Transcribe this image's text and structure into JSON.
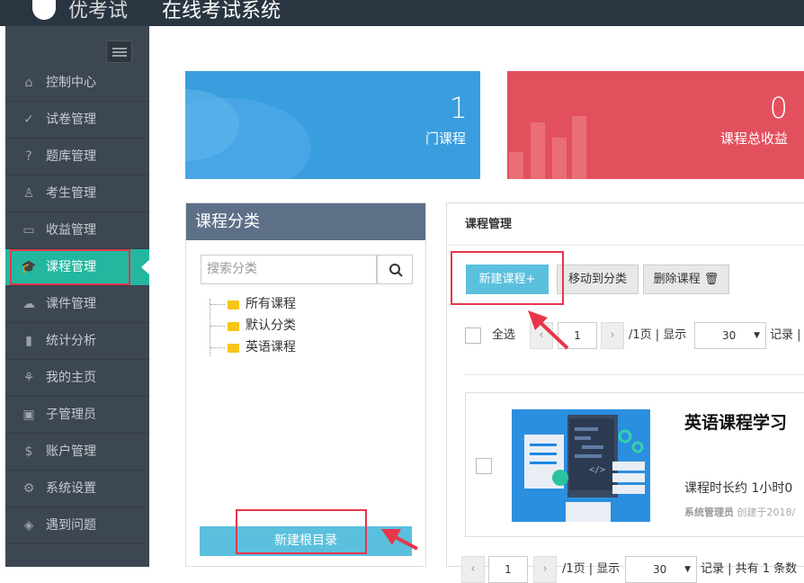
{
  "header": {
    "logo_text": "优考试",
    "title": "在线考试系统"
  },
  "sidebar": {
    "items": [
      {
        "icon": "home-icon",
        "glyph": "⌂",
        "label": "控制中心"
      },
      {
        "icon": "check-circle-icon",
        "glyph": "✓",
        "label": "试卷管理"
      },
      {
        "icon": "question-circle-icon",
        "glyph": "?",
        "label": "题库管理"
      },
      {
        "icon": "user-search-icon",
        "glyph": "♙",
        "label": "考生管理"
      },
      {
        "icon": "card-icon",
        "glyph": "▭",
        "label": "收益管理"
      },
      {
        "icon": "graduation-cap-icon",
        "glyph": "🎓",
        "label": "课程管理",
        "active": true
      },
      {
        "icon": "cloud-upload-icon",
        "glyph": "☁",
        "label": "课件管理"
      },
      {
        "icon": "bar-chart-icon",
        "glyph": "▮",
        "label": "统计分析"
      },
      {
        "icon": "leaf-icon",
        "glyph": "⚘",
        "label": "我的主页"
      },
      {
        "icon": "lock-icon",
        "glyph": "▣",
        "label": "子管理员"
      },
      {
        "icon": "dollar-icon",
        "glyph": "$",
        "label": "账户管理"
      },
      {
        "icon": "gear-icon",
        "glyph": "⚙",
        "label": "系统设置"
      },
      {
        "icon": "tag-icon",
        "glyph": "◈",
        "label": "遇到问题"
      }
    ]
  },
  "stats": {
    "courses": {
      "value": "1",
      "label": "门课程"
    },
    "revenue": {
      "value": "0",
      "label": "课程总收益"
    }
  },
  "category_panel": {
    "title": "课程分类",
    "search_placeholder": "搜索分类",
    "tree": [
      "所有课程",
      "默认分类",
      "英语课程"
    ],
    "new_root_label": "新建根目录"
  },
  "course_panel": {
    "title": "课程管理",
    "new_label": "新建课程+",
    "move_label": "移动到分类",
    "delete_label": "删除课程 🗑",
    "select_all": "全选",
    "page_value": "1",
    "page_suffix": "/1页 | 显示",
    "page_size": "30",
    "records_text": "记录 |",
    "bottom_text": "/1页 | 显示",
    "bottom_records": "记录 | 共有 1 条数",
    "course": {
      "title": "英语课程学习",
      "duration": "课程时长约 1小时0",
      "author": "系统管理员",
      "created": "创建于2018/"
    }
  },
  "colors": {
    "sidebar_bg": "#3d4752",
    "active": "#23b7a0",
    "blue": "#3a9ddd",
    "red": "#e3505d",
    "highlight": "#e8364a"
  }
}
